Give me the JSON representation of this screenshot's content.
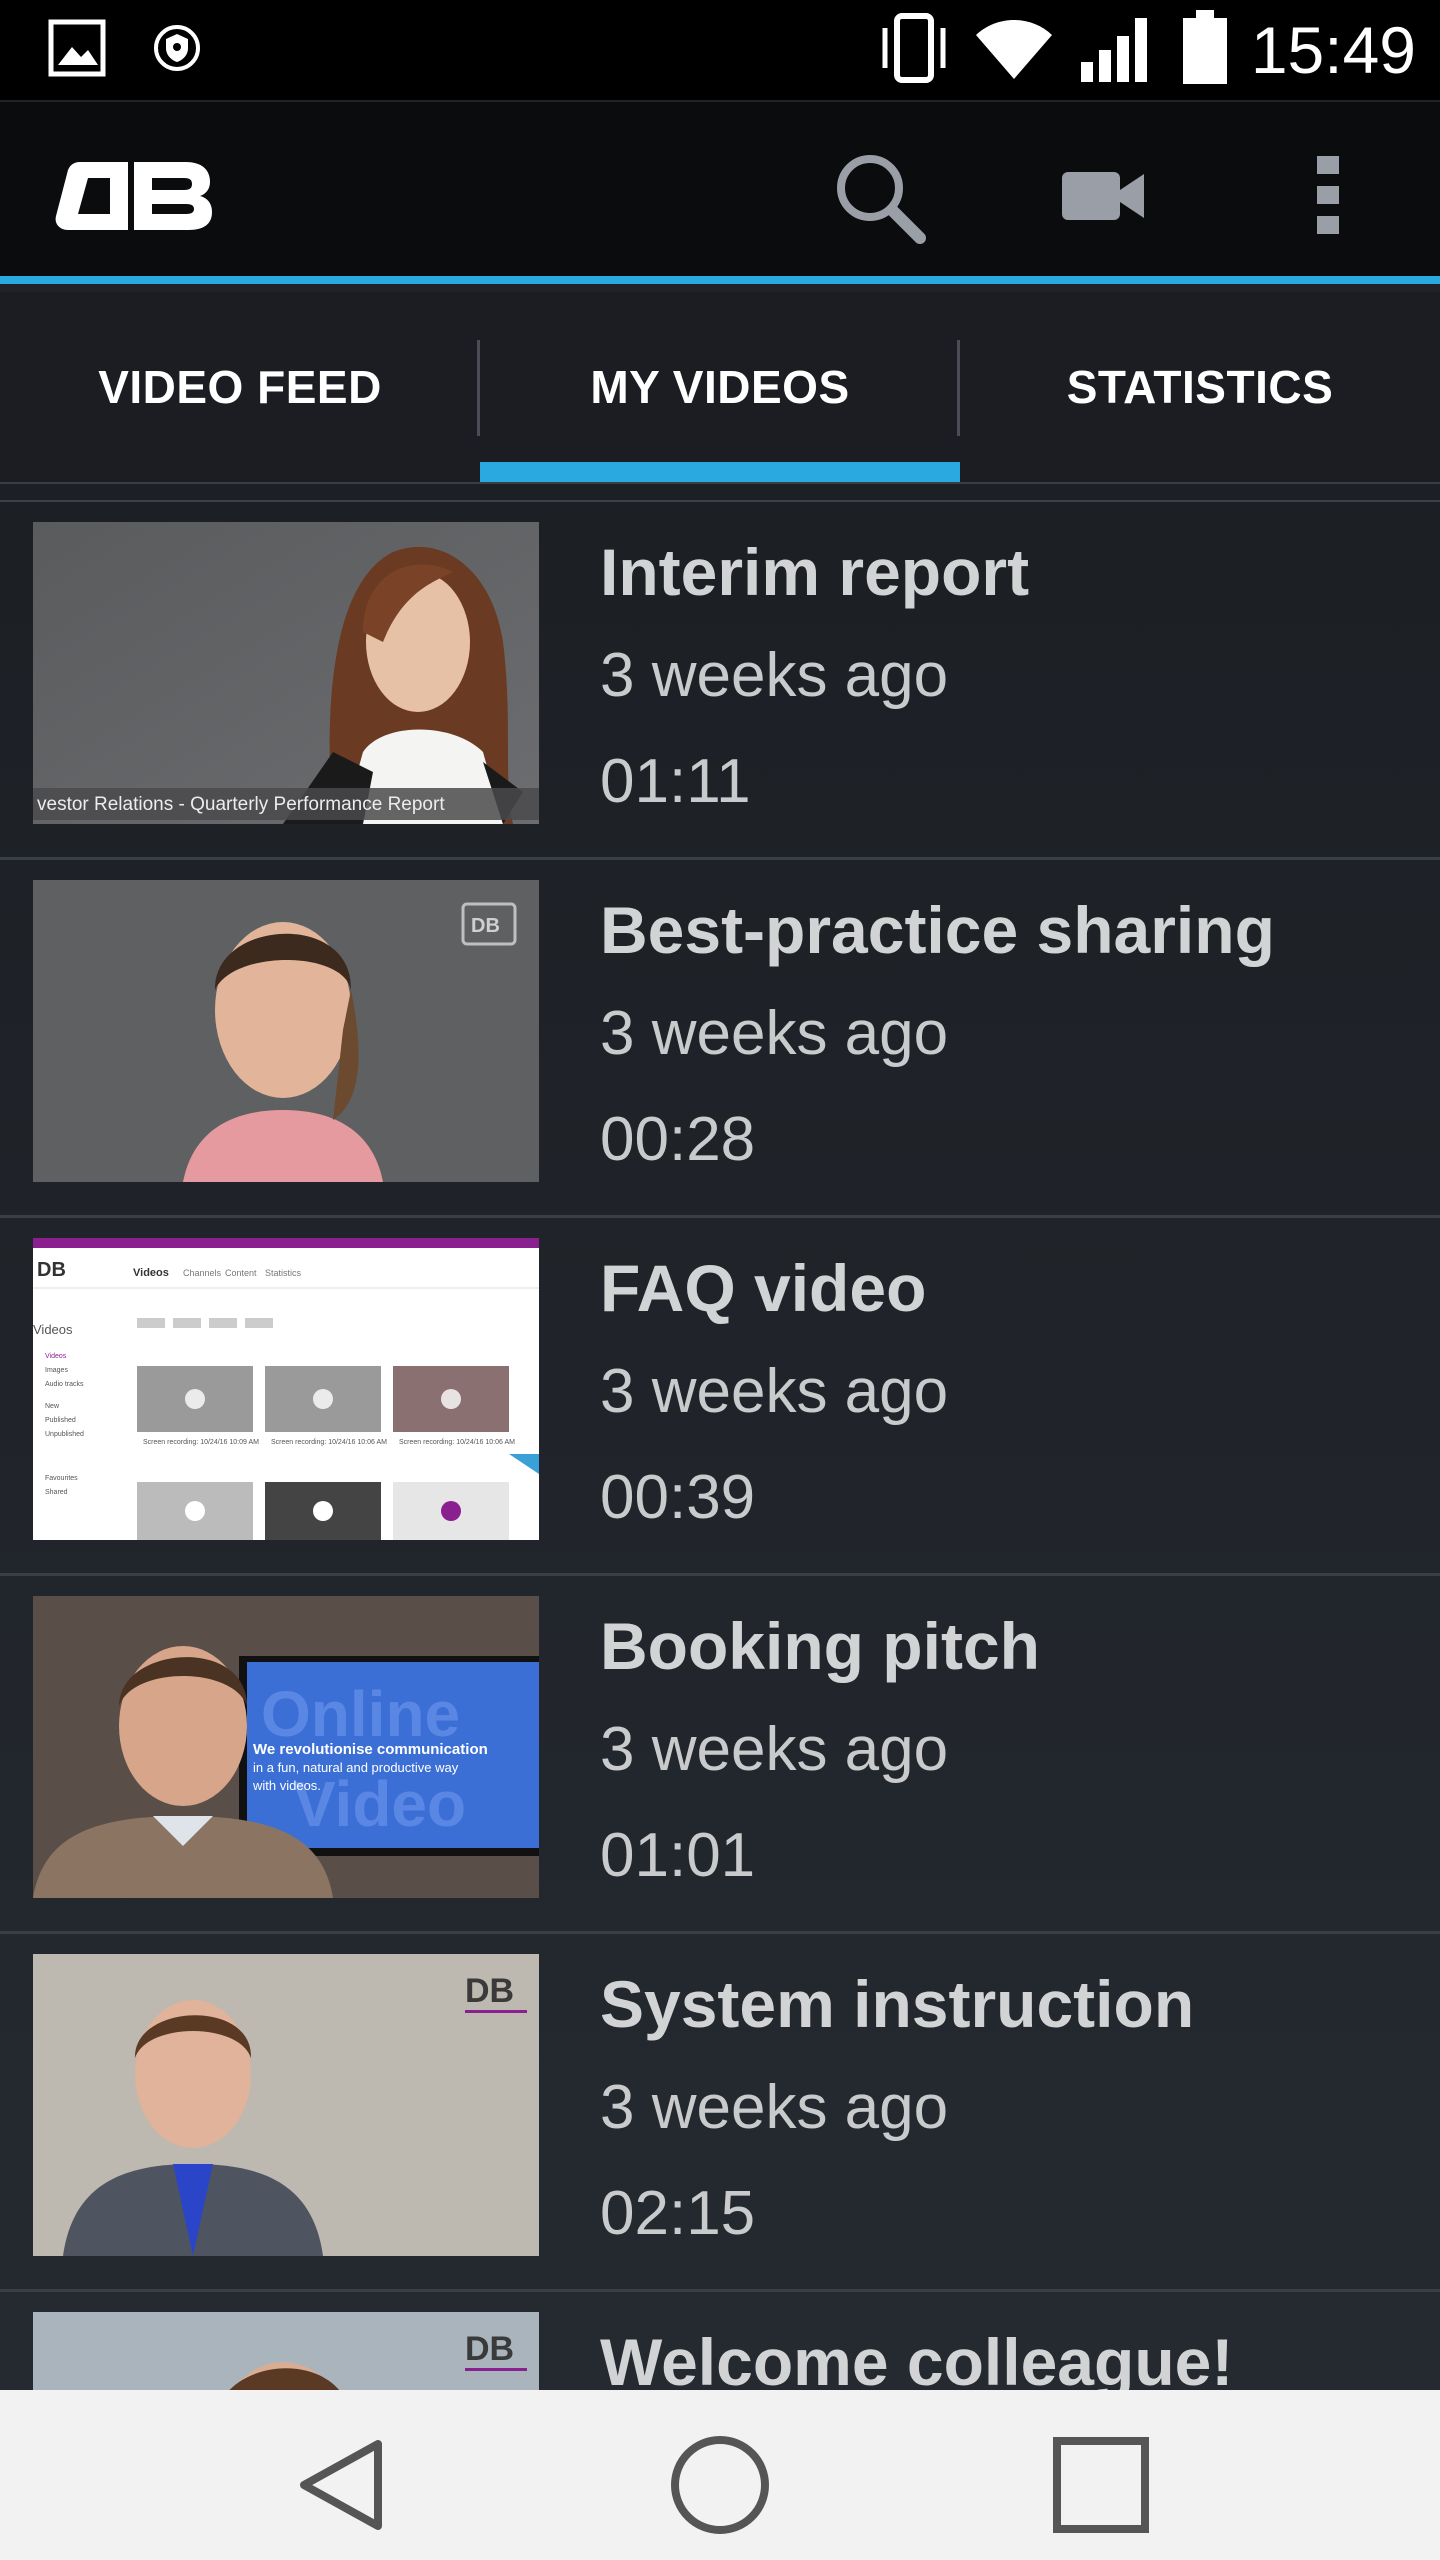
{
  "status_bar": {
    "time": "15:49",
    "icons": [
      "gallery-icon",
      "shield-icon",
      "vibrate-icon",
      "wifi-icon",
      "signal-icon",
      "battery-icon"
    ]
  },
  "app_bar": {
    "logo": "DB",
    "actions": [
      "search-icon",
      "video-camera-icon",
      "overflow-menu-icon"
    ],
    "accent_color": "#2aa8e0"
  },
  "tabs": [
    {
      "label": "VIDEO FEED",
      "selected": false
    },
    {
      "label": "MY VIDEOS",
      "selected": true
    },
    {
      "label": "STATISTICS",
      "selected": false
    }
  ],
  "videos": [
    {
      "title": "Interim report",
      "age": "3 weeks ago",
      "duration": "01:11",
      "thumb_caption": "vestor Relations - Quarterly Performance Report"
    },
    {
      "title": "Best-practice sharing",
      "age": "3 weeks ago",
      "duration": "00:28"
    },
    {
      "title": "FAQ video",
      "age": "3 weeks ago",
      "duration": "00:39",
      "thumb_text": {
        "heading": "Videos",
        "menu": [
          "Channels",
          "Content",
          "Statistics"
        ],
        "side_title": "Videos",
        "side_items": [
          "Videos",
          "Images",
          "Audio tracks",
          "New",
          "Published",
          "Unpublished",
          "Favourites",
          "Shared"
        ],
        "cards": [
          "Screen recording: 10/24/16 10:09 AM",
          "Screen recording: 10/24/16 10:06 AM",
          "Screen recording: 10/24/16 10:06 AM"
        ]
      }
    },
    {
      "title": "Booking pitch",
      "age": "3 weeks ago",
      "duration": "01:01",
      "thumb_text": {
        "screen_line1": "We revolutionise communication",
        "screen_line2": "in a fun, natural and productive way",
        "screen_line3": "with videos.",
        "bg_word1": "Online",
        "bg_word2": "Video"
      }
    },
    {
      "title": "System instruction",
      "age": "3 weeks ago",
      "duration": "02:15"
    },
    {
      "title": "Welcome colleague!",
      "age": "",
      "duration": ""
    }
  ],
  "nav_bar": {
    "buttons": [
      "back-icon",
      "home-icon",
      "recents-icon"
    ]
  }
}
